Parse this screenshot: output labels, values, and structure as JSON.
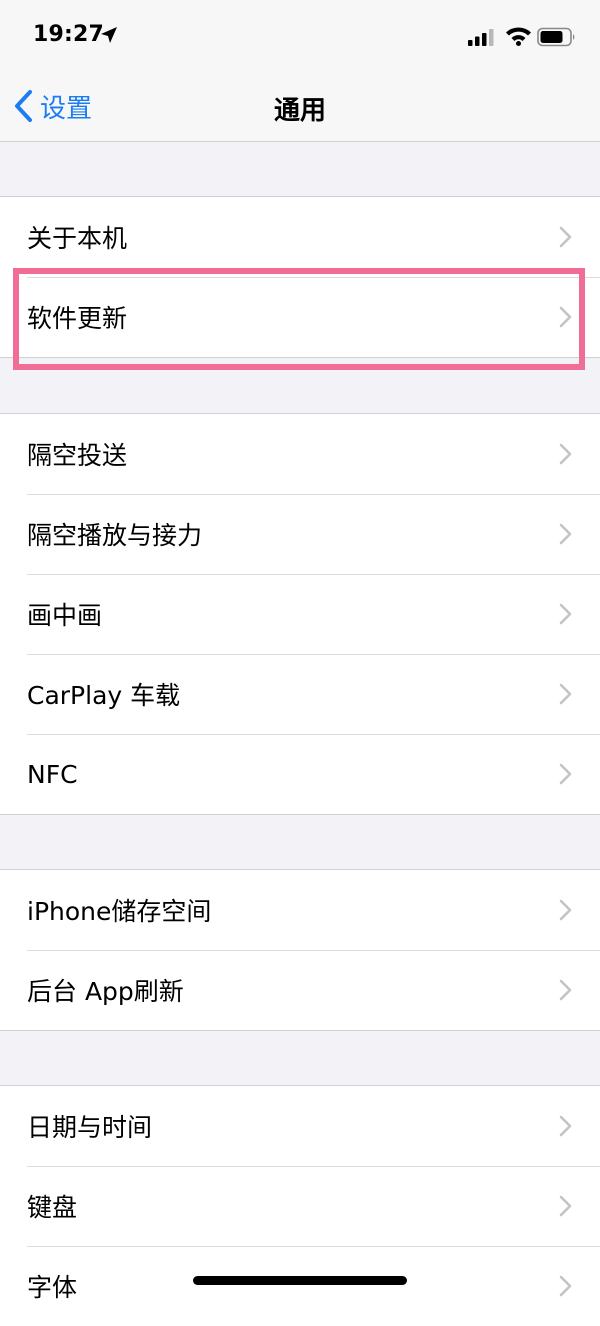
{
  "status_bar": {
    "time": "19:27"
  },
  "nav": {
    "back_label": "设置",
    "title": "通用"
  },
  "groups": [
    {
      "rows": [
        "关于本机",
        "软件更新"
      ]
    },
    {
      "rows": [
        "隔空投送",
        "隔空播放与接力",
        "画中画",
        "CarPlay 车载",
        "NFC"
      ]
    },
    {
      "rows": [
        "iPhone储存空间",
        "后台 App刷新"
      ]
    },
    {
      "rows": [
        "日期与时间",
        "键盘",
        "字体"
      ]
    }
  ],
  "colors": {
    "accent": "#1c7df2",
    "highlight": "#f06d96",
    "background": "#f2f2f7"
  }
}
